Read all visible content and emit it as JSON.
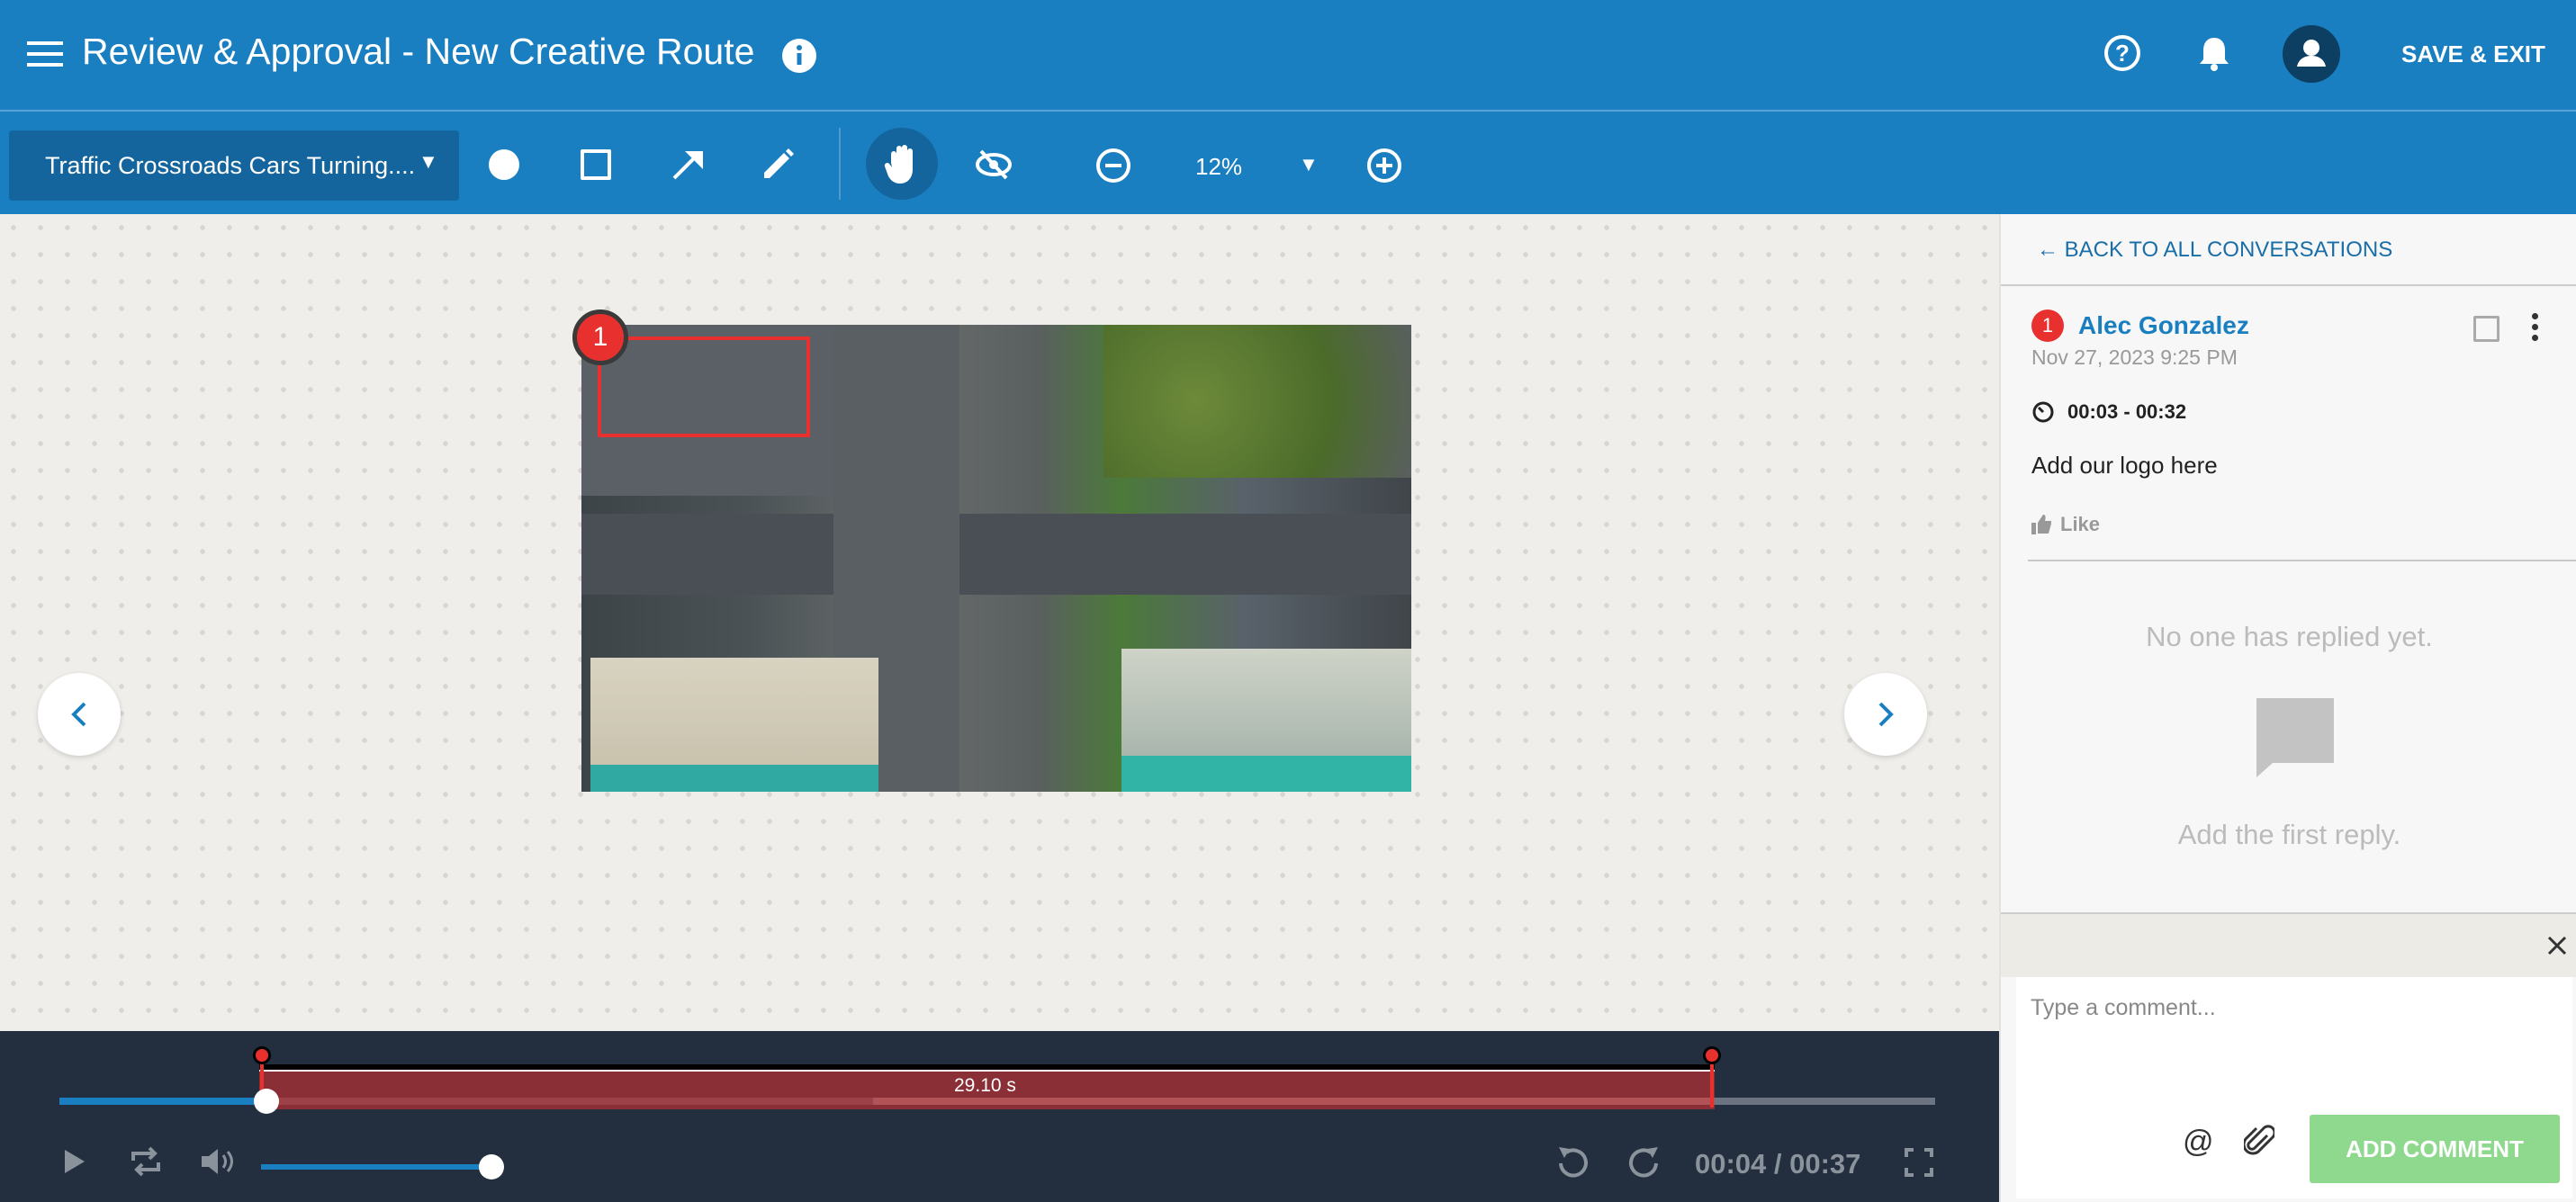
{
  "header": {
    "title": "Review & Approval - New Creative Route",
    "save_exit": "SAVE & EXIT"
  },
  "toolbar": {
    "asset_name": "Traffic Crossroads Cars Turning....",
    "zoom": "12%"
  },
  "canvas": {
    "annotation_number": "1"
  },
  "panel": {
    "back_link": "← BACK TO ALL CONVERSATIONS",
    "comment": {
      "number": "1",
      "author": "Alec Gonzalez",
      "timestamp": "Nov 27, 2023 9:25 PM",
      "time_range": "00:03 - 00:32",
      "text": "Add our logo here",
      "like": "Like"
    },
    "empty_title": "No one has replied yet.",
    "empty_sub": "Add the first reply.",
    "input_placeholder": "Type a comment...",
    "add_button": "ADD COMMENT"
  },
  "player": {
    "range_duration": "29.10 s",
    "time": "00:04 / 00:37",
    "progress": 0.11,
    "volume": 1.0
  },
  "colors": {
    "brand": "#1a7fc1",
    "accent_red": "#e8312f",
    "add_button": "#8fd98f"
  }
}
